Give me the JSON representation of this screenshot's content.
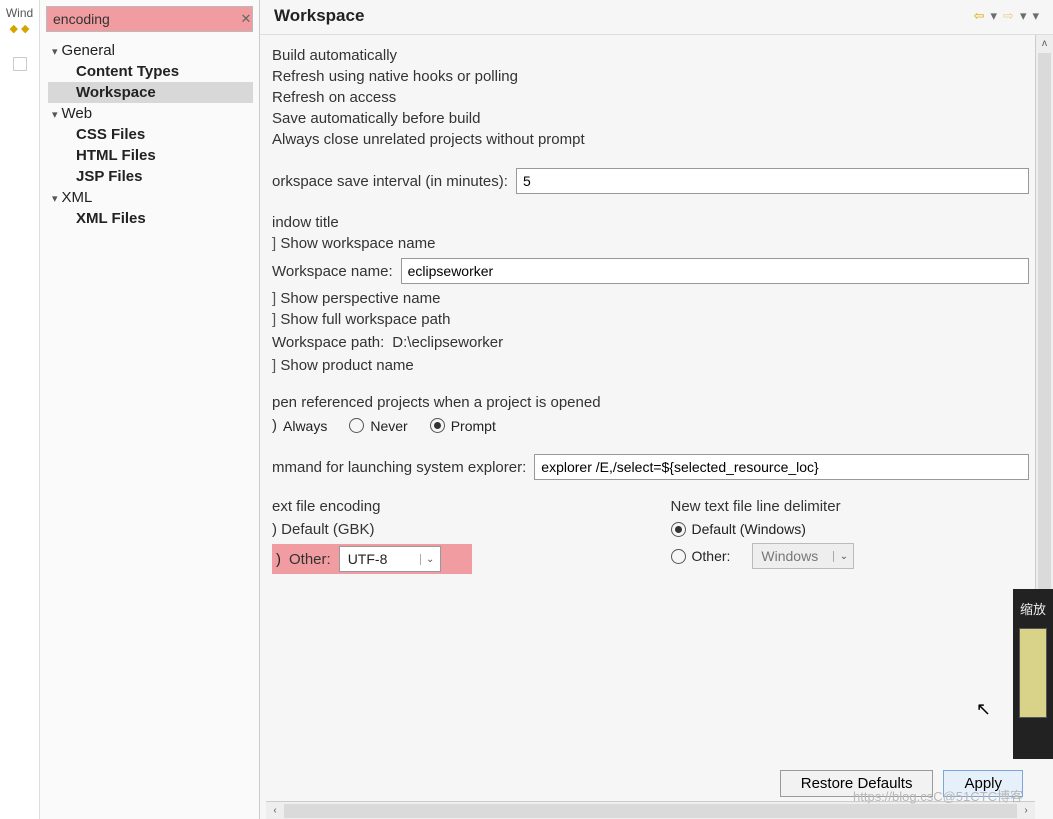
{
  "window_frag": "Wind",
  "filter": {
    "value": "encoding"
  },
  "tree": {
    "general": {
      "label": "General",
      "items": [
        "Content Types",
        "Workspace"
      ],
      "selected": "Workspace"
    },
    "web": {
      "label": "Web",
      "items": [
        "CSS Files",
        "HTML Files",
        "JSP Files"
      ]
    },
    "xml": {
      "label": "XML",
      "items": [
        "XML Files"
      ]
    }
  },
  "page_title": "Workspace",
  "options": {
    "build_auto": "Build automatically",
    "refresh_native": "Refresh using native hooks or polling",
    "refresh_access": "Refresh on access",
    "save_before_build": "Save automatically before build",
    "close_unrelated": "Always close unrelated projects without prompt"
  },
  "save_interval": {
    "label": "orkspace save interval (in minutes):",
    "value": "5"
  },
  "window_title": {
    "heading": "indow title",
    "show_ws_name": "Show workspace name",
    "ws_name_label": "Workspace name:",
    "ws_name_value": "eclipseworker",
    "show_perspective": "Show perspective name",
    "show_full_path": "Show full workspace path",
    "ws_path_label": "Workspace path:",
    "ws_path_value": "D:\\eclipseworker",
    "show_product": "Show product name"
  },
  "open_ref": {
    "heading": "pen referenced projects when a project is opened",
    "options": {
      "always": "Always",
      "never": "Never",
      "prompt": "Prompt"
    },
    "selected": "prompt"
  },
  "explorer": {
    "label": "mmand for launching system explorer:",
    "value": "explorer /E,/select=${selected_resource_loc}"
  },
  "encoding": {
    "heading": "ext file encoding",
    "default_label": "Default (GBK)",
    "other_label": "Other:",
    "other_value": "UTF-8",
    "selected": "other"
  },
  "delimiter": {
    "heading": "New text file line delimiter",
    "default_label": "Default (Windows)",
    "other_label": "Other:",
    "other_value": "Windows",
    "selected": "default"
  },
  "buttons": {
    "restore": "Restore Defaults",
    "apply": "Apply"
  },
  "float_panel_label": "缩放",
  "watermark": "https://blog.csC@51CTC博客"
}
